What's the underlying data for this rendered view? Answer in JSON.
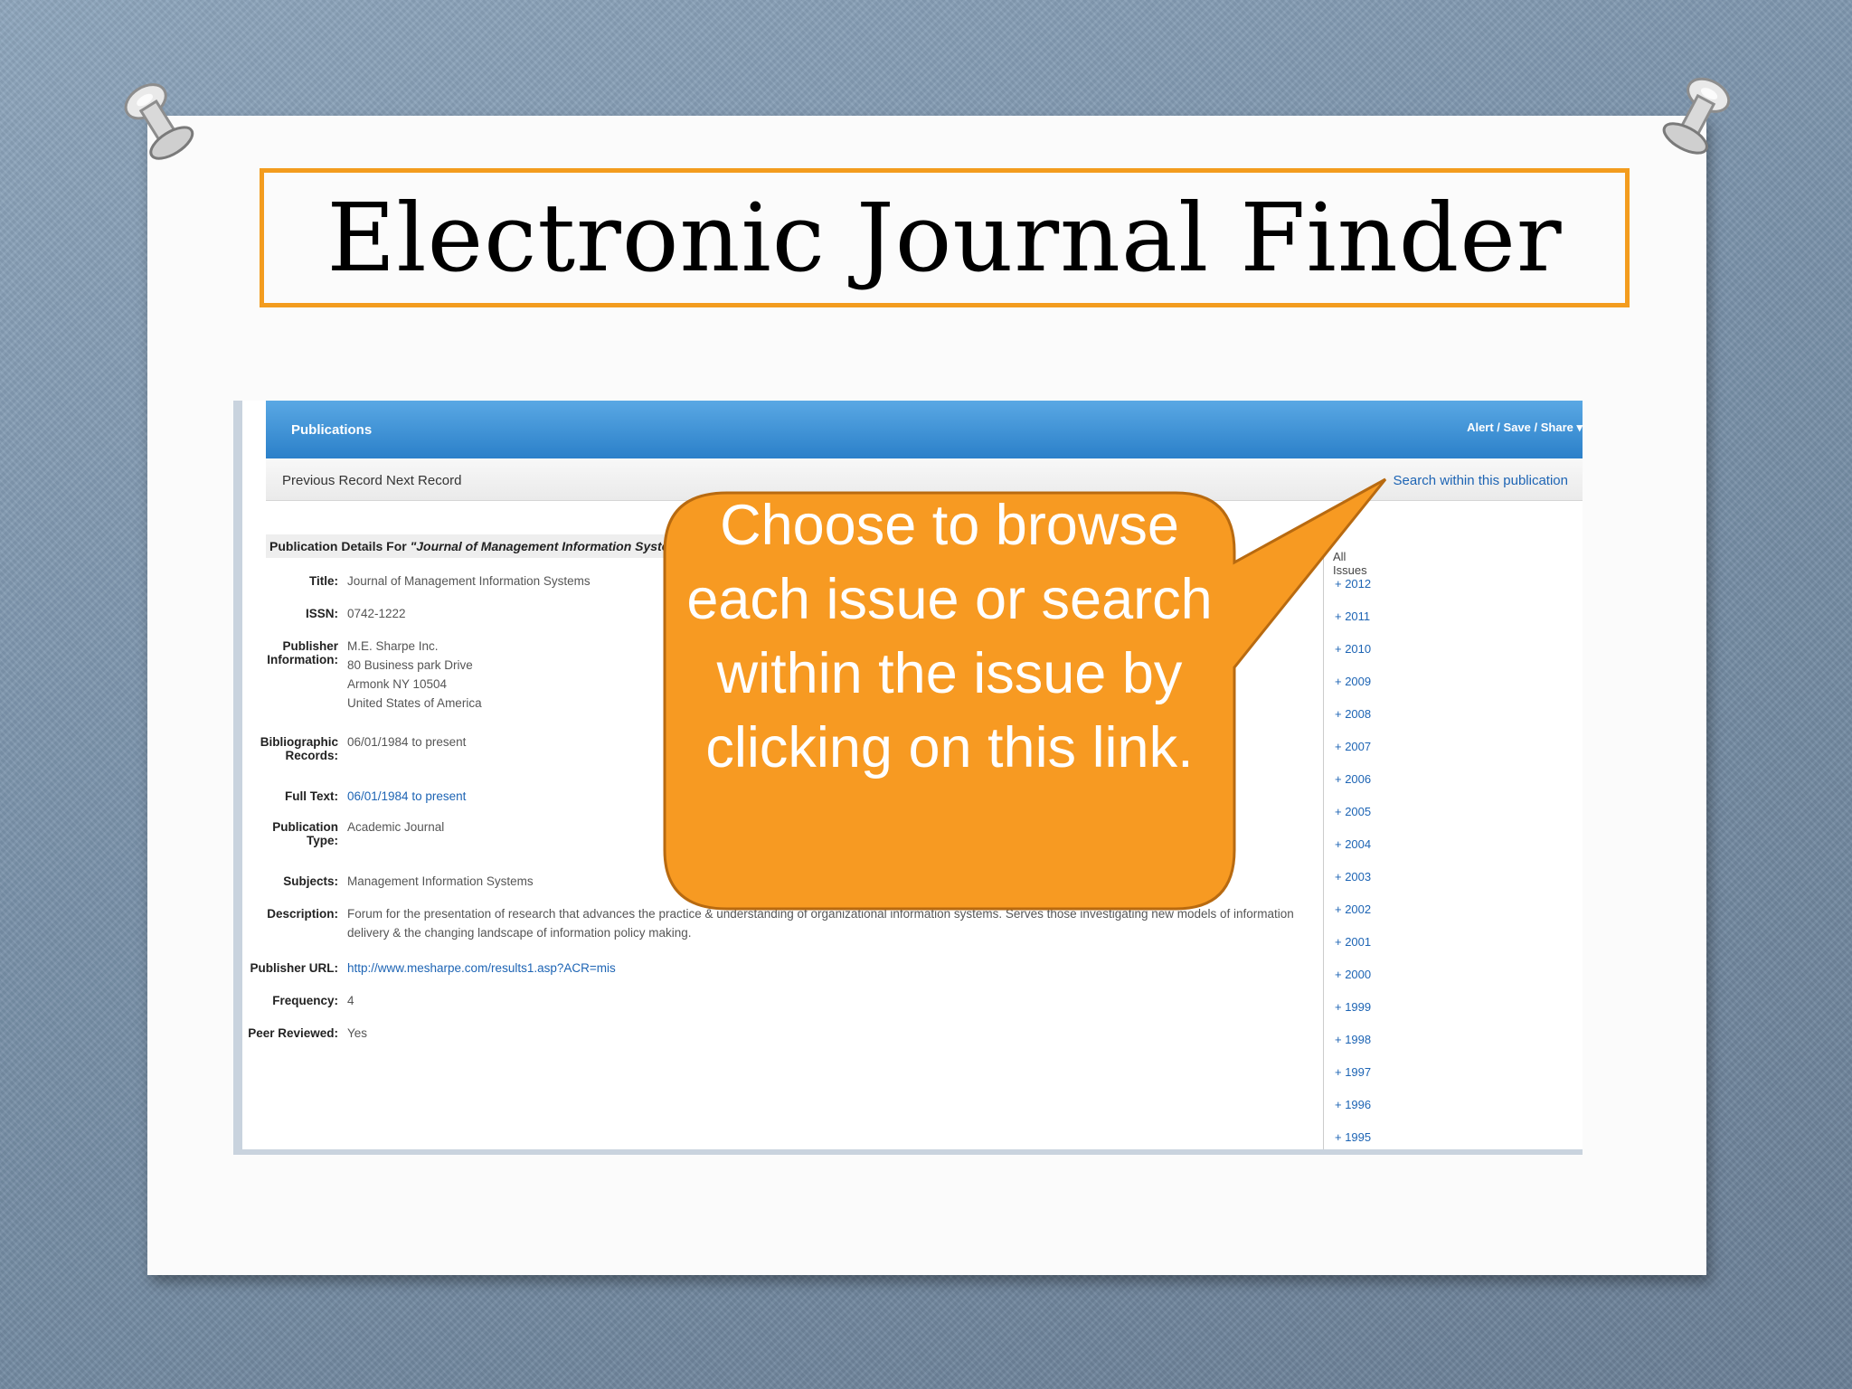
{
  "slide": {
    "title": "Electronic Journal Finder",
    "callout_text": "Choose to browse each issue or search within the issue by clicking on this link."
  },
  "screenshot": {
    "header_left": "Publications",
    "header_right": "Alert / Save / Share ▾",
    "nav_prev_next": "Previous Record Next Record",
    "search_link": "Search within this publication",
    "details_prefix": "Publication Details For ",
    "details_title": "\"Journal of Management Information Systems\"",
    "fields": [
      {
        "label": "Title:",
        "value": "Journal of Management Information Systems"
      },
      {
        "label": "ISSN:",
        "value": "0742-1222"
      },
      {
        "label": "Publisher Information:",
        "value": "M.E. Sharpe Inc. 80 Business park Drive Armonk NY 10504 United States of America"
      },
      {
        "label": "Bibliographic Records:",
        "value": "06/01/1984 to present"
      },
      {
        "label": "Full Text:",
        "value": "06/01/1984 to present"
      },
      {
        "label": "Publication Type:",
        "value": "Academic Journal"
      },
      {
        "label": "Subjects:",
        "value": "Management Information Systems"
      },
      {
        "label": "Description:",
        "value": "Forum for the presentation of research that advances the practice & understanding of organizational information systems. Serves those investigating new models of information delivery & the changing landscape of information policy making."
      },
      {
        "label": "Publisher URL:",
        "value": "http://www.mesharpe.com/results1.asp?ACR=mis"
      },
      {
        "label": "Frequency:",
        "value": "4"
      },
      {
        "label": "Peer Reviewed:",
        "value": "Yes"
      }
    ],
    "publisher_lines": [
      "M.E. Sharpe Inc.",
      "80 Business park Drive",
      "Armonk NY 10504",
      "United States of America"
    ],
    "description_lines": [
      "Forum for the presentation of research that advances the practice & understanding of organizational information systems. Serves those investigating new models of information",
      "delivery & the changing landscape of information policy making."
    ],
    "issues_label": "All Issues",
    "years": [
      "+ 2012",
      "+ 2011",
      "+ 2010",
      "+ 2009",
      "+ 2008",
      "+ 2007",
      "+ 2006",
      "+ 2005",
      "+ 2004",
      "+ 2003",
      "+ 2002",
      "+ 2001",
      "+ 2000",
      "+ 1999",
      "+ 1998",
      "+ 1997",
      "+ 1996",
      "+ 1995"
    ]
  },
  "colors": {
    "title_border": "#f39c1e",
    "callout_fill": "#f79a22",
    "callout_stroke": "#b86a10",
    "header_blue": "#2b80c9",
    "link_blue": "#1d64b4"
  }
}
